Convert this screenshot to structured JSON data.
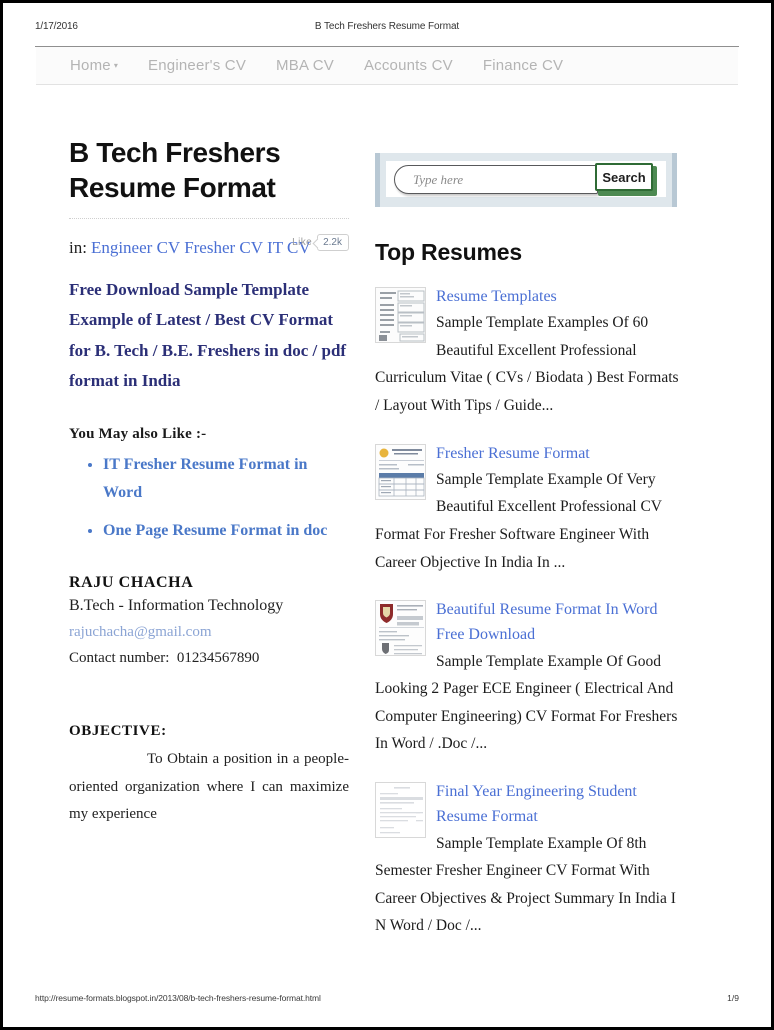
{
  "print": {
    "date": "1/17/2016",
    "doc_title": "B Tech Freshers Resume Format",
    "url": "http://resume-formats.blogspot.in/2013/08/b-tech-freshers-resume-format.html",
    "page_number": "1/9"
  },
  "nav": {
    "items": [
      {
        "label": "Home",
        "has_caret": true,
        "caret": "▾"
      },
      {
        "label": "Engineer's CV",
        "has_caret": false
      },
      {
        "label": "MBA CV",
        "has_caret": false
      },
      {
        "label": "Accounts CV",
        "has_caret": false
      },
      {
        "label": "Finance CV",
        "has_caret": false
      }
    ]
  },
  "post": {
    "title": "B Tech Freshers Resume Format",
    "in_label": "in:",
    "categories": [
      "Engineer CV",
      "Fresher CV",
      "IT CV"
    ],
    "like": {
      "label": "Like",
      "count": "2.2k"
    },
    "lead": "Free Download Sample Template Example of Latest / Best CV Format for B. Tech / B.E. Freshers in doc / pdf format in India",
    "also_like_heading": "You May also Like :-",
    "also_like_items": [
      "IT Fresher Resume Format in Word",
      "One Page Resume Format in doc"
    ],
    "resume": {
      "name": "RAJU CHACHA",
      "degree": "B.Tech - Information Technology",
      "email": "rajuchacha@gmail.com",
      "contact_label": "Contact number:",
      "contact_number": "01234567890",
      "objective_heading": "OBJECTIVE:",
      "objective_body": "To Obtain a position in a people-oriented organization where I can maximize my experience"
    }
  },
  "search": {
    "placeholder": "Type here",
    "value": "",
    "button_label": "Search"
  },
  "sidebar": {
    "widget_title": "Top Resumes",
    "items": [
      {
        "thumb": "document-table-thumbnail",
        "link": "Resume Templates",
        "desc": "Sample Template Examples Of 60 Beautiful Excellent Professional Curriculum Vitae ( CVs / Biodata ) Best Formats / Layout With Tips / Guide..."
      },
      {
        "thumb": "document-blue-table-thumbnail",
        "link": "Fresher Resume Format",
        "desc": "Sample Template Example Of Very Beautiful Excellent Professional CV Format For Fresher Software Engineer With Career Objective In India In ..."
      },
      {
        "thumb": "document-shield-crest-thumbnail",
        "link": "Beautiful Resume Format In Word Free Download",
        "desc": "Sample Template Example Of Good Looking 2 Pager ECE Engineer ( Electrical And Computer Engineering) CV Format For Freshers In Word / .Doc /..."
      },
      {
        "thumb": "document-faint-text-thumbnail",
        "link": "Final Year Engineering Student Resume Format",
        "desc": "Sample Template Example Of 8th Semester Fresher Engineer CV Format With  Career Objectives & Project Summary In India  I N Word / Doc /..."
      }
    ]
  },
  "colors": {
    "link_blue": "#4a6fd4",
    "lead_navy": "#2b2f77",
    "list_blue": "#4a78c8",
    "search_frame": "#dfe7ec",
    "search_button_green": "#2f6b35",
    "nav_grey": "#b4b4b4"
  }
}
